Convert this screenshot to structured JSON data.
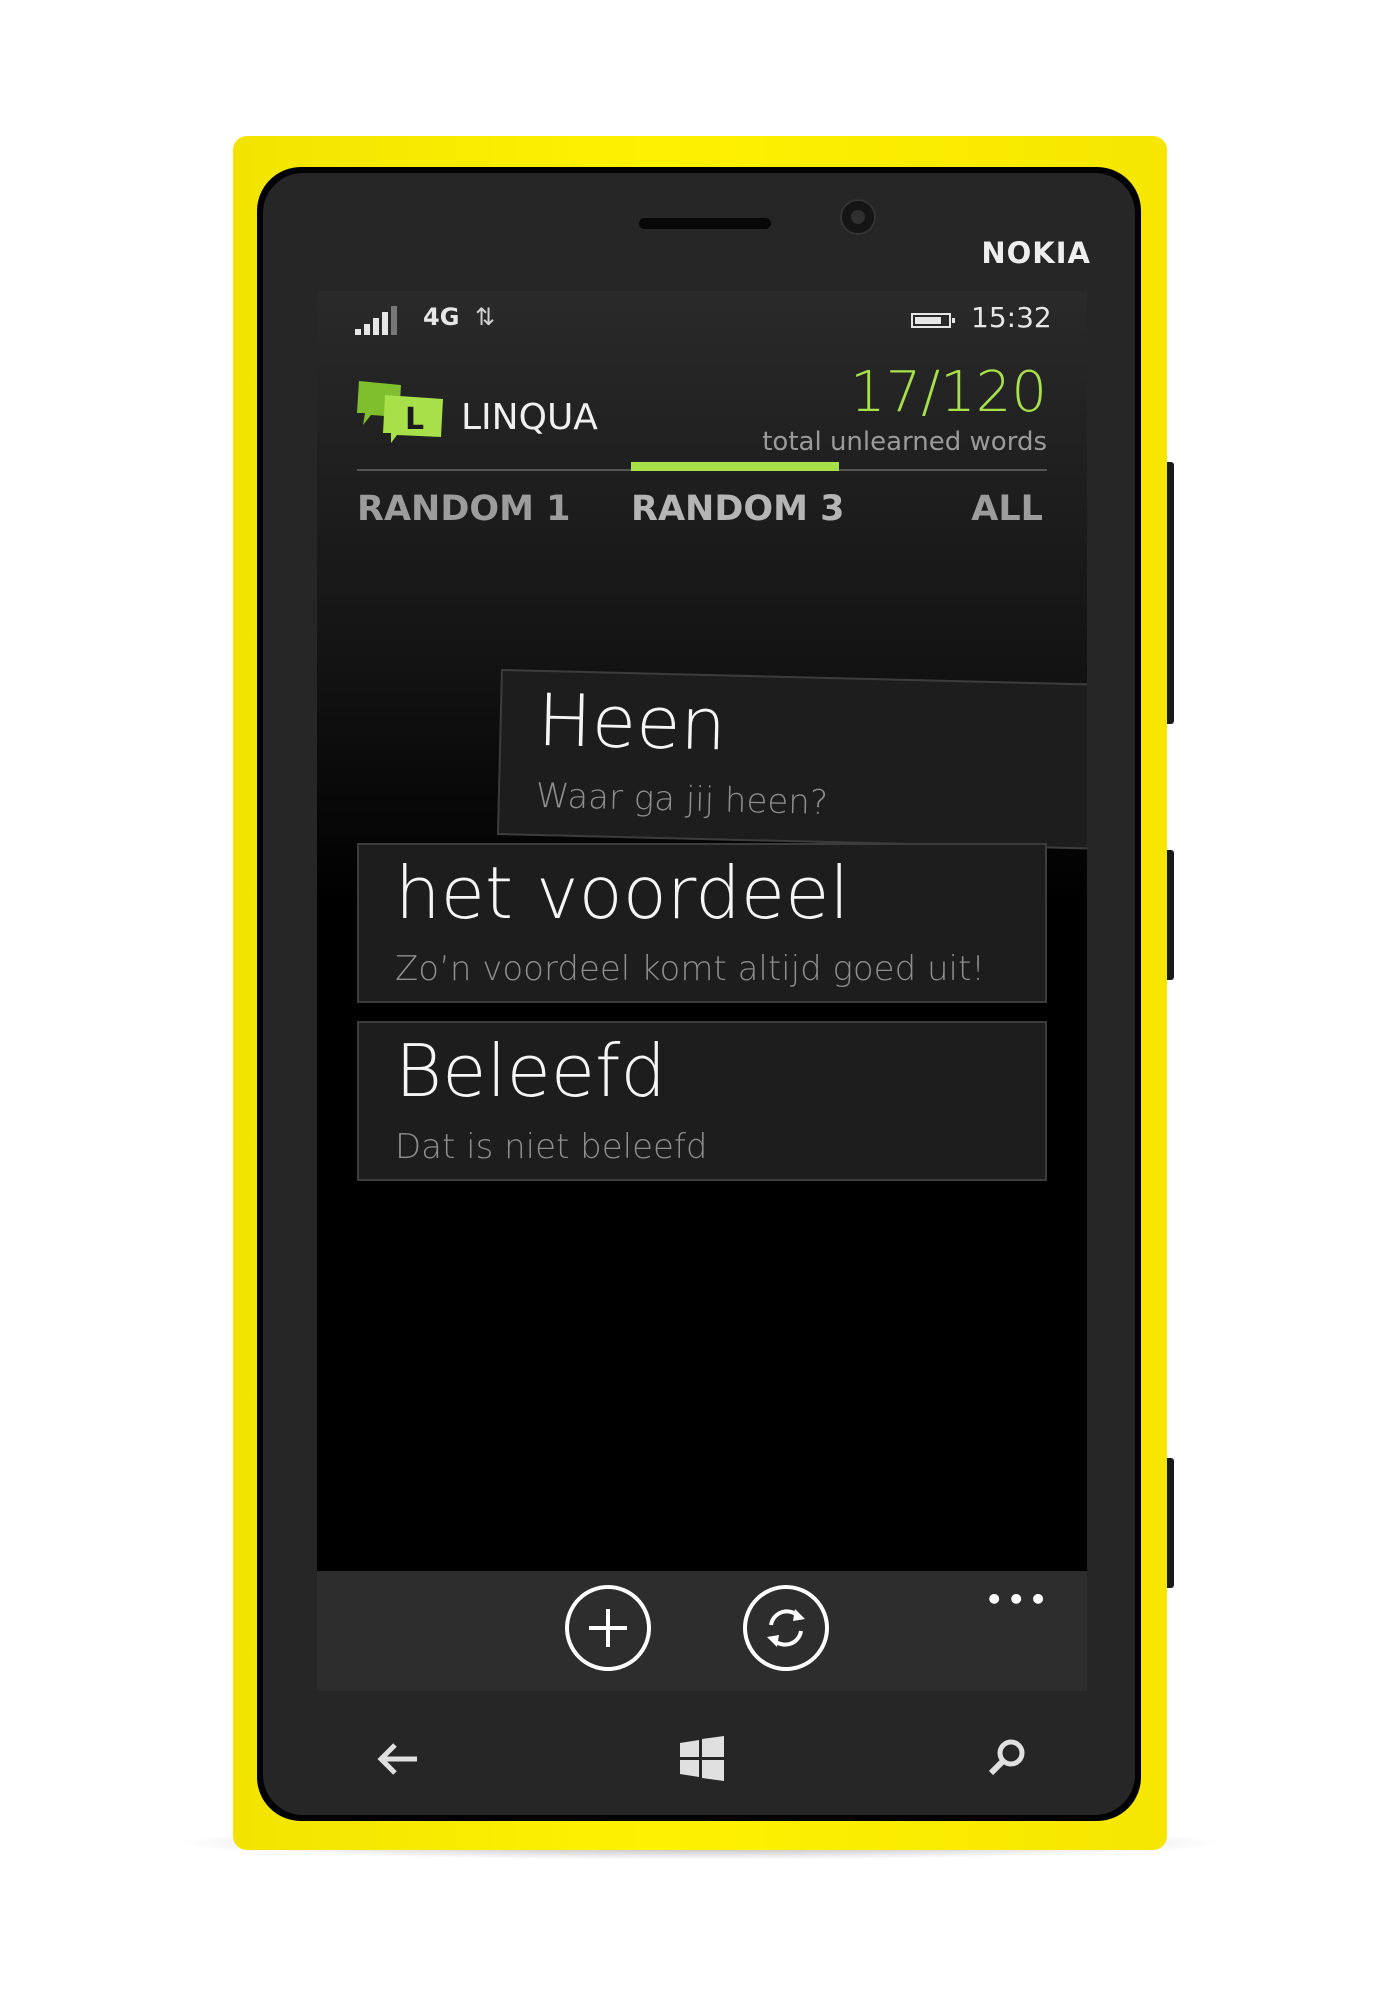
{
  "device": {
    "brand": "NOKIA"
  },
  "status_bar": {
    "network": "4G",
    "time": "15:32"
  },
  "app": {
    "title": "LINQUA",
    "logo_letter": "L",
    "count": "17/120",
    "count_label": "total unlearned words",
    "accent_color": "#a8e04a"
  },
  "tabs": [
    {
      "label": "RANDOM 1"
    },
    {
      "label": "RANDOM 3",
      "active": true
    },
    {
      "label": "ALL"
    }
  ],
  "cards": [
    {
      "word": "Heen",
      "sentence": "Waar ga jij heen?"
    },
    {
      "word": "het voordeel",
      "sentence": "Zo’n voordeel komt altijd goed uit!"
    },
    {
      "word": "Beleefd",
      "sentence": "Dat is niet beleefd"
    }
  ],
  "app_bar": {
    "more": "•••",
    "icons": [
      "add-icon",
      "refresh-icon"
    ]
  },
  "nav_bar": {
    "icons": [
      "back-arrow-icon",
      "windows-start-icon",
      "search-icon"
    ]
  }
}
